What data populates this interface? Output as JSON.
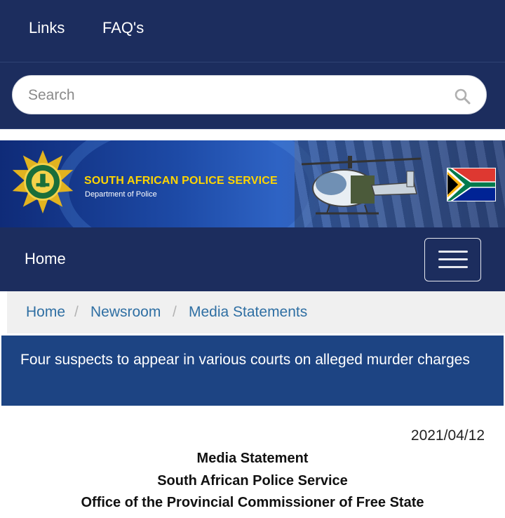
{
  "top_nav": {
    "links": [
      "Links",
      "FAQ's"
    ]
  },
  "search": {
    "placeholder": "Search",
    "icon": "search-icon"
  },
  "banner": {
    "org_name": "SOUTH AFRICAN POLICE SERVICE",
    "org_sub": "Department of Police",
    "colors": {
      "title": "#ffd500",
      "background": "#1d4aa6"
    }
  },
  "main_nav": {
    "home_label": "Home",
    "menu_icon": "hamburger-icon"
  },
  "breadcrumb": {
    "items": [
      "Home",
      "Newsroom",
      "Media Statements"
    ],
    "separator": "/"
  },
  "article": {
    "title": "Four suspects to appear in various courts on alleged murder charges",
    "date": "2021/04/12",
    "lines": [
      "Media Statement",
      "South African Police Service",
      "Office of the Provincial Commissioner of Free State"
    ]
  },
  "colors": {
    "nav": "#1c2d5e",
    "headline": "#1d4483",
    "link": "#2f6fa3"
  }
}
